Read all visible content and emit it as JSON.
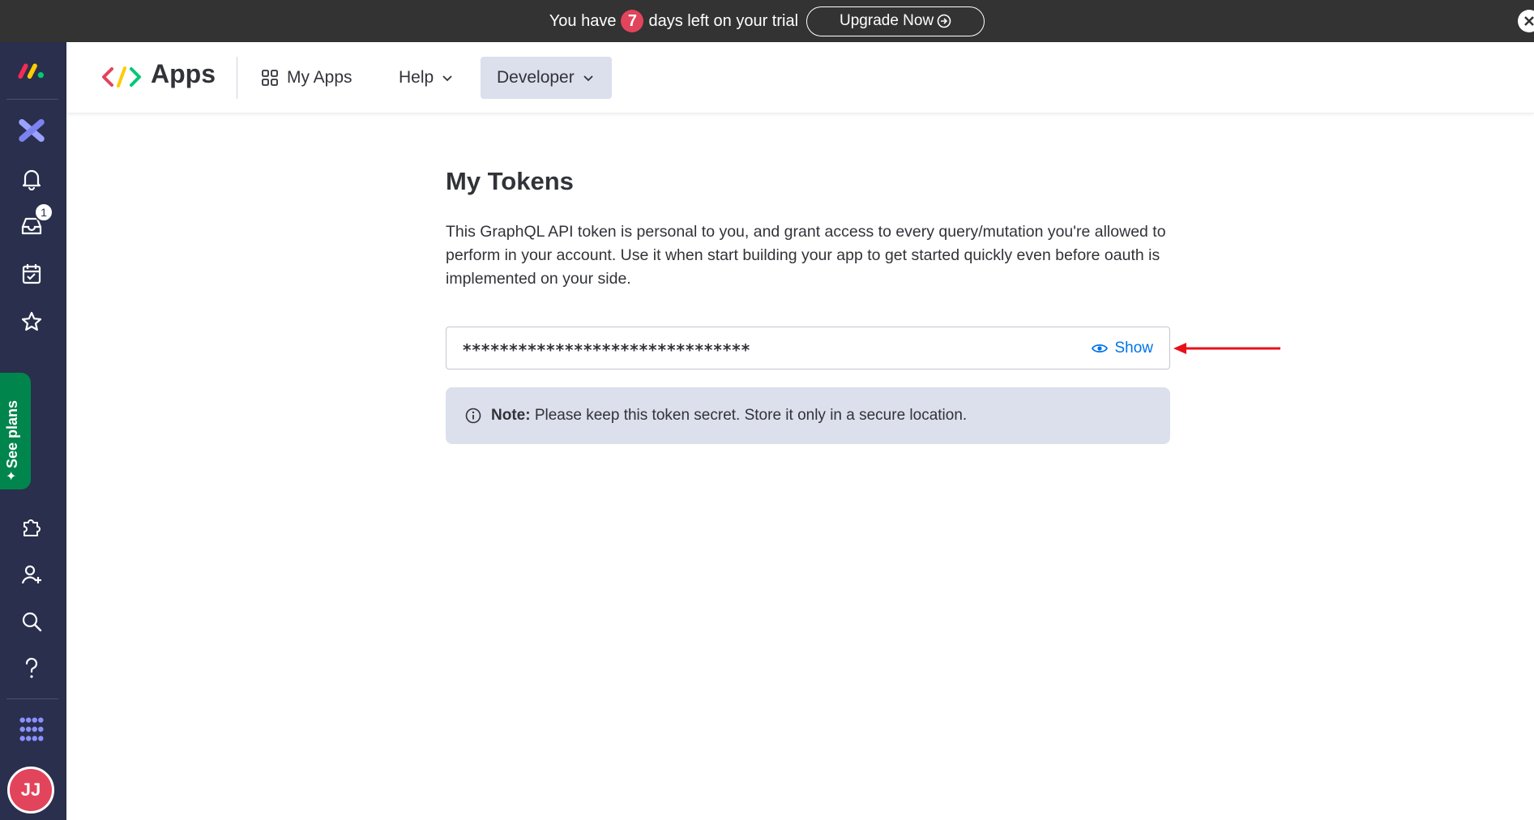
{
  "banner": {
    "prefix": "You have",
    "days": "7",
    "suffix": "days left on your trial",
    "upgrade_label": "Upgrade Now"
  },
  "rail": {
    "inbox_count": "1",
    "see_plans_label": "See plans",
    "avatar_initials": "JJ"
  },
  "nav": {
    "app_title": "Apps",
    "my_apps": "My Apps",
    "help": "Help",
    "developer": "Developer"
  },
  "main": {
    "title": "My Tokens",
    "description": "This GraphQL API token is personal to you, and grant access to every query/mutation you're allowed to perform in your account. Use it when start building your app to get started quickly even before oauth is implemented on your side.",
    "token_masked": "*******************************",
    "show_label": "Show",
    "note_label": "Note:",
    "note_text": "Please keep this token secret. Store it only in a secure location."
  },
  "colors": {
    "accent": "#0073ea",
    "rail_bg": "#292f4c",
    "plans_green": "#00854d",
    "badge_red": "#e2445c",
    "annotation_arrow": "#e8101a"
  },
  "icons": [
    "monday-logo",
    "workspace-x-icon",
    "bell-icon",
    "inbox-icon",
    "calendar-check-icon",
    "star-icon",
    "puzzle-icon",
    "add-user-icon",
    "search-icon",
    "help-icon",
    "apps-grid-icon",
    "code-icon",
    "grid-icon",
    "chevron-down-icon",
    "eye-icon",
    "info-icon",
    "arrow-right-circle-icon",
    "close-icon"
  ]
}
